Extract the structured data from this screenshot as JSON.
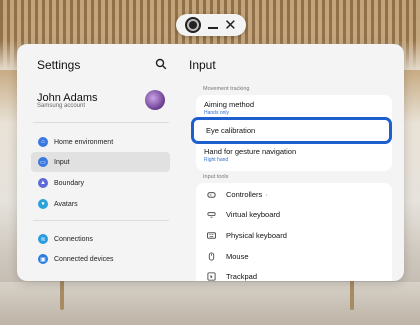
{
  "window_controls": {
    "minimize": "_",
    "close": "✕"
  },
  "settings": {
    "title": "Settings",
    "profile": {
      "name": "John Adams",
      "account": "Samsung account"
    },
    "menu": [
      {
        "label": "Home environment",
        "icon": "home-icon",
        "color": "#3a78e0"
      },
      {
        "label": "Input",
        "icon": "input-icon",
        "color": "#3a78e0"
      },
      {
        "label": "Boundary",
        "icon": "boundary-icon",
        "color": "#5b6ad6"
      },
      {
        "label": "Avatars",
        "icon": "avatar-icon",
        "color": "#2aa1d8"
      },
      {
        "label": "Connections",
        "icon": "wifi-icon",
        "color": "#2a9be0"
      },
      {
        "label": "Connected devices",
        "icon": "devices-icon",
        "color": "#2a7ce0"
      }
    ]
  },
  "input": {
    "title": "Input",
    "movement_tracking": {
      "label": "Movement tracking",
      "aiming_method": {
        "title": "Aiming method",
        "value": "Hands only"
      },
      "eye_calibration": {
        "title": "Eye calibration"
      },
      "hand_gesture": {
        "title": "Hand for gesture navigation",
        "value": "Right hand"
      }
    },
    "input_tools": {
      "label": "Input tools",
      "items": [
        {
          "label": "Controllers",
          "suffix": "·",
          "icon": "controller-icon"
        },
        {
          "label": "Virtual keyboard",
          "icon": "virtual-keyboard-icon"
        },
        {
          "label": "Physical keyboard",
          "icon": "keyboard-icon"
        },
        {
          "label": "Mouse",
          "icon": "mouse-icon"
        },
        {
          "label": "Trackpad",
          "icon": "trackpad-icon"
        }
      ]
    }
  }
}
